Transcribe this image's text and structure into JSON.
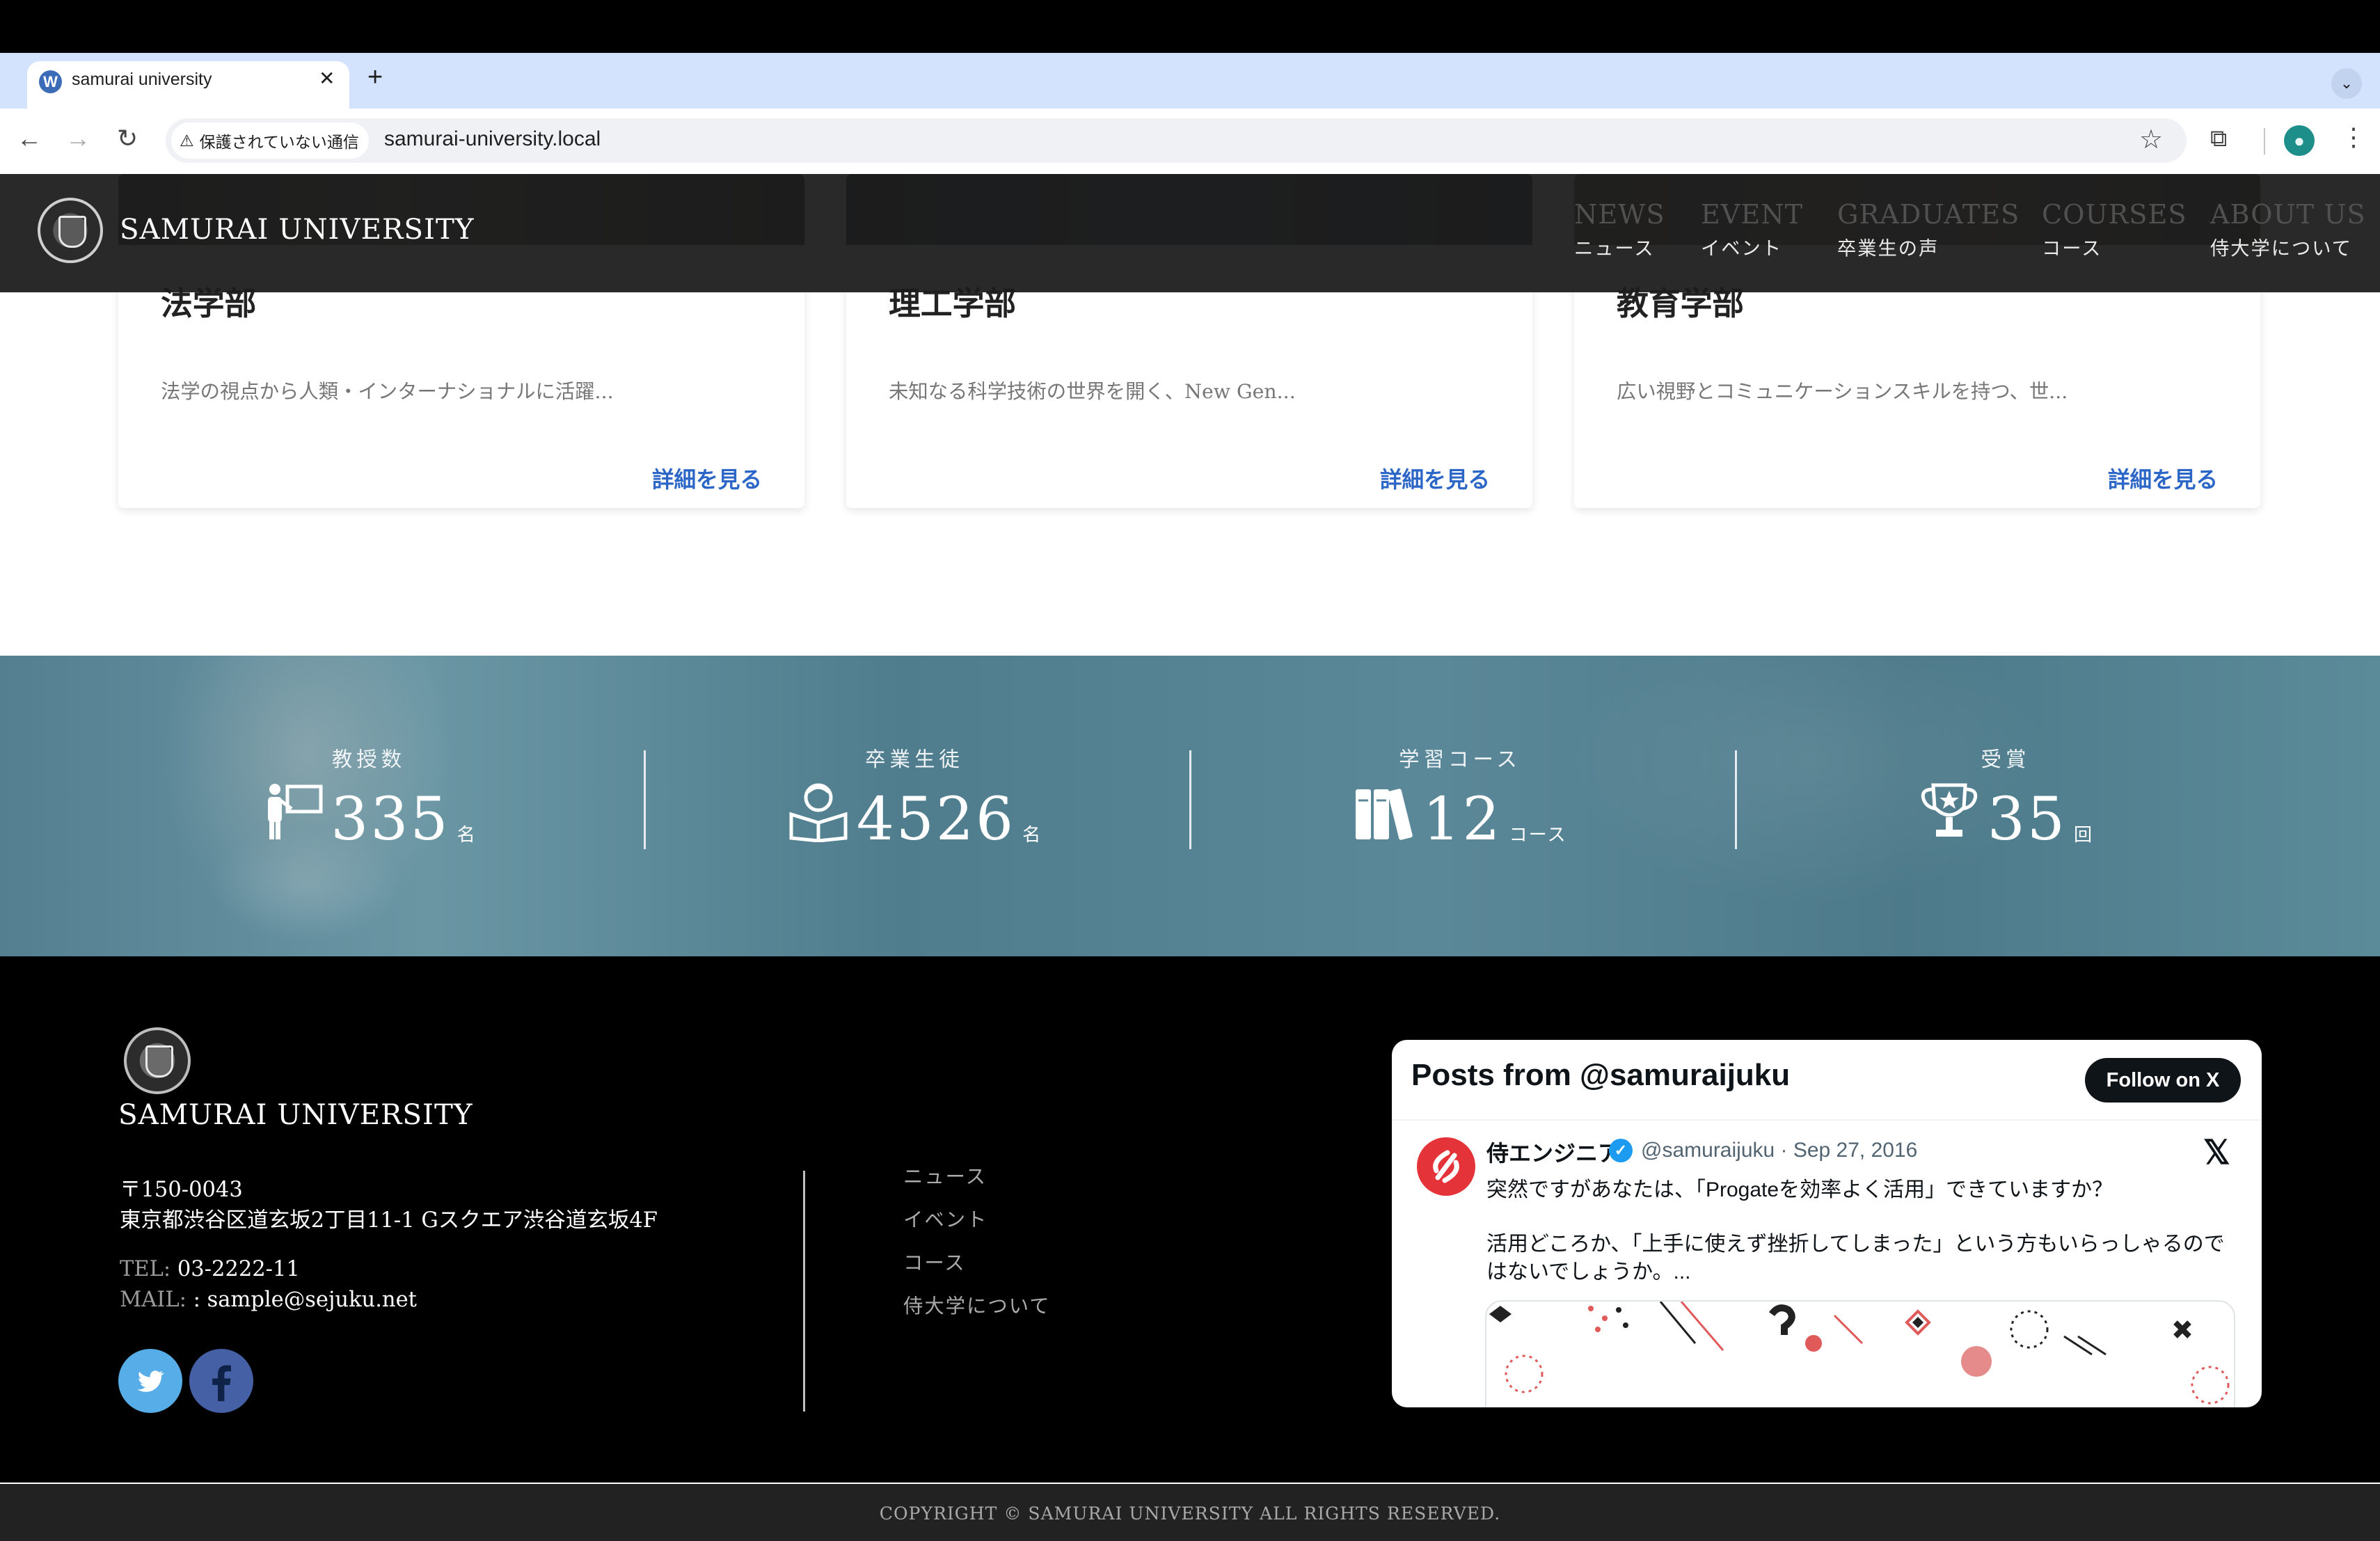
{
  "browser": {
    "tab_title": "samurai university",
    "tab_close": "✕",
    "new_tab": "+",
    "security_label": "保護されていない通信",
    "url": "samurai-university.local"
  },
  "header": {
    "site_title": "SAMURAI UNIVERSITY",
    "nav": [
      {
        "en": "NEWS",
        "ja": "ニュース"
      },
      {
        "en": "EVENT",
        "ja": "イベント"
      },
      {
        "en": "GRADUATES",
        "ja": "卒業生の声"
      },
      {
        "en": "COURSES",
        "ja": "コース"
      },
      {
        "en": "ABOUT US",
        "ja": "侍大学について"
      }
    ]
  },
  "faculties": [
    {
      "title": "法学部",
      "desc": "法学の視点から人類・インターナショナルに活躍...",
      "link": "詳細を見る"
    },
    {
      "title": "理工学部",
      "desc": "未知なる科学技術の世界を開く、New Gen...",
      "link": "詳細を見る"
    },
    {
      "title": "教育学部",
      "desc": "広い視野とコミュニケーションスキルを持つ、世...",
      "link": "詳細を見る"
    }
  ],
  "stats": [
    {
      "label": "教授数",
      "value": "335",
      "unit": "名",
      "icon": "professor-icon"
    },
    {
      "label": "卒業生徒",
      "value": "4526",
      "unit": "名",
      "icon": "graduate-reading-icon"
    },
    {
      "label": "学習コース",
      "value": "12",
      "unit": "コース",
      "icon": "books-icon"
    },
    {
      "label": "受賞",
      "value": "35",
      "unit": "回",
      "icon": "trophy-icon"
    }
  ],
  "footer": {
    "title": "SAMURAI UNIVERSITY",
    "postal": "〒150-0043",
    "address": "東京都渋谷区道玄坂2丁目11-1 Gスクエア渋谷道玄坂4F",
    "tel_key": "TEL: ",
    "tel": "03-2222-11",
    "mail_key": "MAIL: ",
    "mail": ": sample@sejuku.net",
    "links": [
      "ニュース",
      "イベント",
      "コース",
      "侍大学について"
    ],
    "copyright": "COPYRIGHT © SAMURAI UNIVERSITY ALL RIGHTS RESERVED."
  },
  "twitter": {
    "heading": "Posts from @samuraijuku",
    "follow": "Follow on X",
    "name": "侍エンジニア",
    "handle": "@samuraijuku · Sep 27, 2016",
    "lines": [
      "突然ですがあなたは、「Progateを効率よく活用」できていますか？",
      "活用どころか、「上手に使えず挫折してしまった」という方もいらっしゃるので",
      "はないでしょうか。..."
    ]
  },
  "colors": {
    "link_blue": "#2c67c8",
    "stats_teal": "#5b8898",
    "twitter_blue": "#57ade8",
    "facebook_blue": "#4660a6"
  }
}
